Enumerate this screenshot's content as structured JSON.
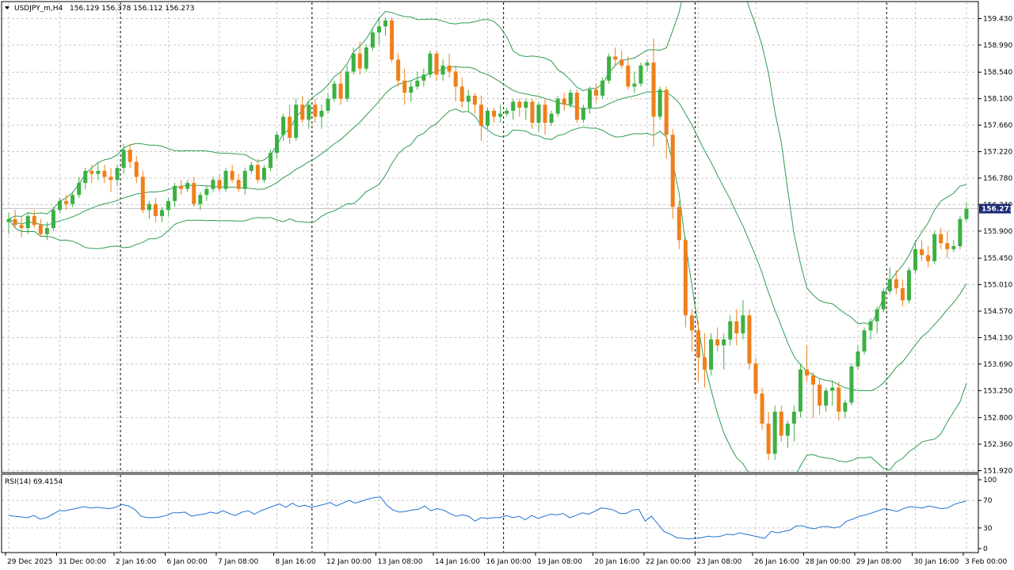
{
  "header": {
    "symbol": "USDJPY_m,H4",
    "ohlc": "156.129 156.378 156.112 156.273"
  },
  "indicator": {
    "label": "RSI(14) 69.4154"
  },
  "colors": {
    "bull": "#3cb043",
    "bear": "#f07f1a",
    "band": "#2e9e4f",
    "rsi": "#1e73d2",
    "grid": "#c8c8c8",
    "price_tag": "#1c2a78"
  },
  "chart_data": {
    "type": "candlestick",
    "price_ticks": [
      "159.430",
      "158.990",
      "158.540",
      "158.100",
      "157.660",
      "157.220",
      "156.780",
      "156.340",
      "155.900",
      "155.450",
      "155.010",
      "154.570",
      "154.130",
      "153.690",
      "153.250",
      "152.800",
      "152.360",
      "151.920"
    ],
    "price_range": [
      151.9,
      159.7
    ],
    "current_price": "156.273",
    "rsi_ticks": [
      "100",
      "70",
      "30",
      "0"
    ],
    "rsi_range": [
      0,
      100
    ],
    "time_labels": [
      "29 Dec 2025",
      "31 Dec 00:00",
      "2 Jan 16:00",
      "6 Jan 00:00",
      "7 Jan 08:00",
      "8 Jan 16:00",
      "12 Jan 00:00",
      "13 Jan 08:00",
      "14 Jan 16:00",
      "16 Jan 00:00",
      "19 Jan 08:00",
      "20 Jan 16:00",
      "22 Jan 00:00",
      "23 Jan 08:00",
      "26 Jan 16:00",
      "28 Jan 00:00",
      "29 Jan 08:00",
      "30 Jan 16:00",
      "3 Feb 00:00"
    ],
    "period_separators_after_candle": [
      18,
      48,
      78,
      108,
      138
    ],
    "candles": [
      [
        156.05,
        156.2,
        155.85,
        156.1
      ],
      [
        156.1,
        156.25,
        155.95,
        156.0
      ],
      [
        156.0,
        156.15,
        155.8,
        155.95
      ],
      [
        155.95,
        156.2,
        155.85,
        156.15
      ],
      [
        156.15,
        156.25,
        155.95,
        156.0
      ],
      [
        156.0,
        156.1,
        155.8,
        155.85
      ],
      [
        155.85,
        156.05,
        155.75,
        155.95
      ],
      [
        155.95,
        156.3,
        155.9,
        156.25
      ],
      [
        156.25,
        156.45,
        156.2,
        156.4
      ],
      [
        156.4,
        156.5,
        156.25,
        156.35
      ],
      [
        156.35,
        156.55,
        156.3,
        156.5
      ],
      [
        156.5,
        156.8,
        156.45,
        156.7
      ],
      [
        156.7,
        156.95,
        156.6,
        156.9
      ],
      [
        156.9,
        157.0,
        156.7,
        156.85
      ],
      [
        156.85,
        157.05,
        156.75,
        156.9
      ],
      [
        156.9,
        157.0,
        156.7,
        156.8
      ],
      [
        156.8,
        156.95,
        156.55,
        156.75
      ],
      [
        156.75,
        157.0,
        156.65,
        156.95
      ],
      [
        156.95,
        157.35,
        156.85,
        157.25
      ],
      [
        157.25,
        157.35,
        156.95,
        157.05
      ],
      [
        157.05,
        157.15,
        156.7,
        156.8
      ],
      [
        156.8,
        156.9,
        156.2,
        156.25
      ],
      [
        156.25,
        156.4,
        156.1,
        156.35
      ],
      [
        156.35,
        156.45,
        156.05,
        156.15
      ],
      [
        156.15,
        156.3,
        156.05,
        156.25
      ],
      [
        156.25,
        156.45,
        156.15,
        156.4
      ],
      [
        156.4,
        156.7,
        156.3,
        156.65
      ],
      [
        156.65,
        156.75,
        156.5,
        156.6
      ],
      [
        156.6,
        156.75,
        156.55,
        156.7
      ],
      [
        156.7,
        156.8,
        156.3,
        156.35
      ],
      [
        156.35,
        156.55,
        156.25,
        156.5
      ],
      [
        156.5,
        156.65,
        156.4,
        156.6
      ],
      [
        156.6,
        156.8,
        156.55,
        156.75
      ],
      [
        156.75,
        156.85,
        156.55,
        156.6
      ],
      [
        156.6,
        156.95,
        156.55,
        156.9
      ],
      [
        156.9,
        157.0,
        156.7,
        156.75
      ],
      [
        156.75,
        156.85,
        156.55,
        156.6
      ],
      [
        156.6,
        156.95,
        156.5,
        156.9
      ],
      [
        156.9,
        157.05,
        156.85,
        157.0
      ],
      [
        157.0,
        157.1,
        156.7,
        156.75
      ],
      [
        156.75,
        157.0,
        156.7,
        156.95
      ],
      [
        156.95,
        157.25,
        156.9,
        157.2
      ],
      [
        157.2,
        157.55,
        157.1,
        157.5
      ],
      [
        157.5,
        157.85,
        157.4,
        157.8
      ],
      [
        157.8,
        158.0,
        157.35,
        157.45
      ],
      [
        157.45,
        158.1,
        157.4,
        158.0
      ],
      [
        158.0,
        158.15,
        157.7,
        157.75
      ],
      [
        157.75,
        158.05,
        157.6,
        158.0
      ],
      [
        158.0,
        158.1,
        157.7,
        157.8
      ],
      [
        157.8,
        158.0,
        157.6,
        157.9
      ],
      [
        157.9,
        158.2,
        157.85,
        158.1
      ],
      [
        158.1,
        158.4,
        158.05,
        158.35
      ],
      [
        158.35,
        158.55,
        158.0,
        158.1
      ],
      [
        158.1,
        158.65,
        158.05,
        158.55
      ],
      [
        158.55,
        158.95,
        158.5,
        158.85
      ],
      [
        158.85,
        159.05,
        158.5,
        158.6
      ],
      [
        158.6,
        159.0,
        158.55,
        158.95
      ],
      [
        158.95,
        159.25,
        158.9,
        159.2
      ],
      [
        159.2,
        159.45,
        159.0,
        159.3
      ],
      [
        159.3,
        159.45,
        159.15,
        159.4
      ],
      [
        159.4,
        159.45,
        158.7,
        158.75
      ],
      [
        158.75,
        158.85,
        158.3,
        158.4
      ],
      [
        158.4,
        158.6,
        158.0,
        158.2
      ],
      [
        158.2,
        158.4,
        158.05,
        158.3
      ],
      [
        158.3,
        158.55,
        158.25,
        158.4
      ],
      [
        158.4,
        158.6,
        158.3,
        158.5
      ],
      [
        158.5,
        158.9,
        158.45,
        158.85
      ],
      [
        158.85,
        158.9,
        158.4,
        158.5
      ],
      [
        158.5,
        158.75,
        158.4,
        158.65
      ],
      [
        158.65,
        158.85,
        158.45,
        158.55
      ],
      [
        158.55,
        158.65,
        158.05,
        158.3
      ],
      [
        158.3,
        158.45,
        157.95,
        158.05
      ],
      [
        158.05,
        158.25,
        157.9,
        158.15
      ],
      [
        158.15,
        158.2,
        157.85,
        158.0
      ],
      [
        158.0,
        158.15,
        157.4,
        157.65
      ],
      [
        157.65,
        157.95,
        157.6,
        157.9
      ],
      [
        157.9,
        157.95,
        157.7,
        157.8
      ],
      [
        157.8,
        158.0,
        157.7,
        157.85
      ],
      [
        157.85,
        157.95,
        157.8,
        157.9
      ],
      [
        157.9,
        158.1,
        157.75,
        158.05
      ],
      [
        158.05,
        158.1,
        157.8,
        157.95
      ],
      [
        157.95,
        158.1,
        157.75,
        158.05
      ],
      [
        158.05,
        158.1,
        157.6,
        157.7
      ],
      [
        157.7,
        158.05,
        157.55,
        158.0
      ],
      [
        158.0,
        158.1,
        157.5,
        157.7
      ],
      [
        157.7,
        157.9,
        157.65,
        157.85
      ],
      [
        157.85,
        158.15,
        157.8,
        158.1
      ],
      [
        158.1,
        158.2,
        157.9,
        158.0
      ],
      [
        158.0,
        158.25,
        157.95,
        158.2
      ],
      [
        158.2,
        158.25,
        157.7,
        157.75
      ],
      [
        157.75,
        158.0,
        157.7,
        157.95
      ],
      [
        157.95,
        158.3,
        157.85,
        158.25
      ],
      [
        158.25,
        158.35,
        158.05,
        158.15
      ],
      [
        158.15,
        158.45,
        158.1,
        158.4
      ],
      [
        158.4,
        158.85,
        158.35,
        158.8
      ],
      [
        158.8,
        158.95,
        158.65,
        158.75
      ],
      [
        158.75,
        158.9,
        158.6,
        158.65
      ],
      [
        158.65,
        158.8,
        158.25,
        158.3
      ],
      [
        158.3,
        158.55,
        158.2,
        158.35
      ],
      [
        158.35,
        158.7,
        158.3,
        158.65
      ],
      [
        158.65,
        158.75,
        158.55,
        158.7
      ],
      [
        158.7,
        159.1,
        157.3,
        157.8
      ],
      [
        157.8,
        158.3,
        157.75,
        158.25
      ],
      [
        158.25,
        158.3,
        157.1,
        157.5
      ],
      [
        157.5,
        157.6,
        156.1,
        156.3
      ],
      [
        156.3,
        156.4,
        155.6,
        155.75
      ],
      [
        155.75,
        155.8,
        154.3,
        154.5
      ],
      [
        154.5,
        154.6,
        153.9,
        154.25
      ],
      [
        154.25,
        154.4,
        153.4,
        153.8
      ],
      [
        153.8,
        154.2,
        153.3,
        153.6
      ],
      [
        153.6,
        154.2,
        153.5,
        154.1
      ],
      [
        154.1,
        154.3,
        153.9,
        154.0
      ],
      [
        154.0,
        154.2,
        153.6,
        154.1
      ],
      [
        154.1,
        154.5,
        154.0,
        154.4
      ],
      [
        154.4,
        154.6,
        154.0,
        154.2
      ],
      [
        154.2,
        154.75,
        154.1,
        154.5
      ],
      [
        154.5,
        154.6,
        153.6,
        153.7
      ],
      [
        153.7,
        153.8,
        153.1,
        153.2
      ],
      [
        153.2,
        153.3,
        152.6,
        152.7
      ],
      [
        152.7,
        152.9,
        152.1,
        152.2
      ],
      [
        152.2,
        153.0,
        152.1,
        152.9
      ],
      [
        152.9,
        153.0,
        152.4,
        152.5
      ],
      [
        152.5,
        152.75,
        152.3,
        152.7
      ],
      [
        152.7,
        153.0,
        152.4,
        152.9
      ],
      [
        152.9,
        153.7,
        152.8,
        153.6
      ],
      [
        153.6,
        154.0,
        153.4,
        153.5
      ],
      [
        153.5,
        153.55,
        152.8,
        153.35
      ],
      [
        153.35,
        153.45,
        152.85,
        153.0
      ],
      [
        153.0,
        153.3,
        152.9,
        153.25
      ],
      [
        153.25,
        153.4,
        153.0,
        153.3
      ],
      [
        153.3,
        153.4,
        152.75,
        152.9
      ],
      [
        152.9,
        153.1,
        152.8,
        153.05
      ],
      [
        153.05,
        153.7,
        153.0,
        153.65
      ],
      [
        153.65,
        154.0,
        153.6,
        153.9
      ],
      [
        153.9,
        154.3,
        153.85,
        154.25
      ],
      [
        154.25,
        154.45,
        154.1,
        154.4
      ],
      [
        154.4,
        154.65,
        154.2,
        154.6
      ],
      [
        154.6,
        154.95,
        154.55,
        154.9
      ],
      [
        154.9,
        155.3,
        154.85,
        155.1
      ],
      [
        155.1,
        155.25,
        154.85,
        154.95
      ],
      [
        154.95,
        155.1,
        154.65,
        154.75
      ],
      [
        154.75,
        155.3,
        154.7,
        155.25
      ],
      [
        155.25,
        155.75,
        155.2,
        155.6
      ],
      [
        155.6,
        155.75,
        155.4,
        155.5
      ],
      [
        155.5,
        155.65,
        155.3,
        155.4
      ],
      [
        155.4,
        155.9,
        155.35,
        155.85
      ],
      [
        155.85,
        155.95,
        155.6,
        155.7
      ],
      [
        155.7,
        155.9,
        155.45,
        155.6
      ],
      [
        155.6,
        155.75,
        155.55,
        155.65
      ],
      [
        155.65,
        156.15,
        155.6,
        156.1
      ],
      [
        156.1,
        156.38,
        156.05,
        156.27
      ]
    ],
    "rsi": [
      48,
      47,
      46,
      45,
      48,
      43,
      45,
      50,
      55,
      55,
      57,
      59,
      61,
      59,
      60,
      59,
      58,
      60,
      64,
      62,
      57,
      47,
      45,
      45,
      46,
      48,
      52,
      52,
      53,
      47,
      49,
      50,
      53,
      51,
      55,
      51,
      48,
      53,
      55,
      50,
      55,
      58,
      62,
      65,
      60,
      66,
      61,
      63,
      60,
      62,
      64,
      67,
      62,
      66,
      70,
      66,
      69,
      72,
      74,
      75,
      63,
      56,
      53,
      54,
      56,
      57,
      62,
      55,
      58,
      56,
      51,
      47,
      49,
      47,
      40,
      45,
      44,
      45,
      45,
      48,
      45,
      47,
      42,
      48,
      44,
      47,
      50,
      49,
      51,
      45,
      48,
      52,
      50,
      54,
      59,
      58,
      56,
      51,
      51,
      56,
      57,
      40,
      47,
      36,
      25,
      21,
      16,
      15,
      14,
      15,
      16,
      18,
      17,
      18,
      21,
      20,
      23,
      21,
      19,
      17,
      15,
      25,
      23,
      25,
      27,
      33,
      33,
      30,
      29,
      32,
      32,
      30,
      32,
      40,
      43,
      47,
      49,
      52,
      55,
      58,
      56,
      54,
      58,
      61,
      60,
      59,
      62,
      60,
      58,
      59,
      64,
      67,
      69
    ]
  }
}
